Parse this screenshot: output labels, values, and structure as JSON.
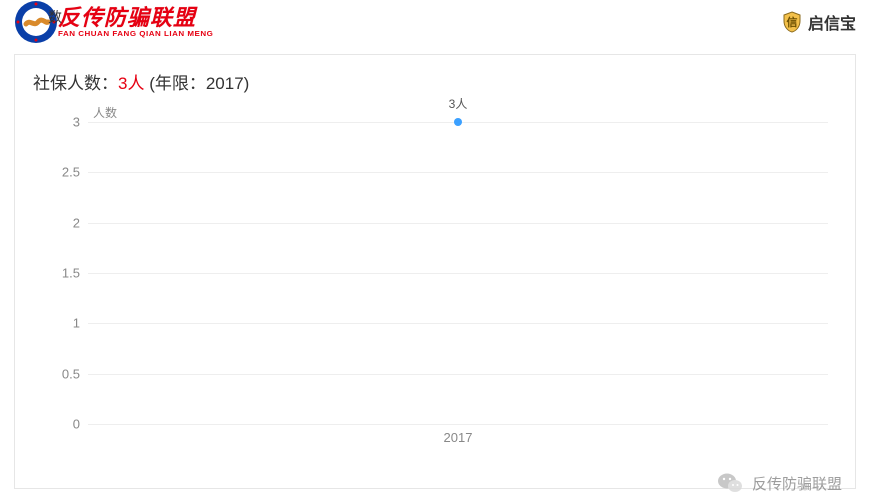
{
  "header": {
    "brand_overlap": "数",
    "brand_title": "反传防骗联盟",
    "brand_sub": "FAN CHUAN FANG QIAN LIAN MENG",
    "right_text": "启信宝"
  },
  "card": {
    "title_prefix": "社保人数：",
    "title_value": "3人",
    "title_suffix": " (年限：2017)"
  },
  "footer": {
    "text": "反传防骗联盟"
  },
  "chart_data": {
    "type": "scatter",
    "title": "",
    "ylabel": "人数",
    "xlabel": "",
    "ylim": [
      0,
      3
    ],
    "yticks": [
      0,
      0.5,
      1,
      1.5,
      2,
      2.5,
      3
    ],
    "categories": [
      "2017"
    ],
    "series": [
      {
        "name": "人数",
        "values": [
          3
        ],
        "point_labels": [
          "3人"
        ]
      }
    ]
  }
}
